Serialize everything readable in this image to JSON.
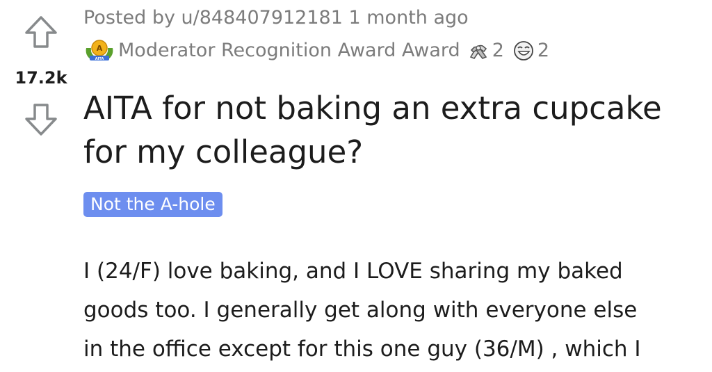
{
  "vote": {
    "score": "17.2k",
    "upvote_icon": "arrow-up-icon",
    "downvote_icon": "arrow-down-icon"
  },
  "post": {
    "posted_by_prefix": "Posted by",
    "username": "u/848407912181",
    "age": "1 month ago",
    "awards": {
      "moderator_badge_icon": "aita-moderator-badge-icon",
      "moderator_award_label": "Moderator Recognition Award Award",
      "items": [
        {
          "icon": "arm-wrestling-icon",
          "count": "2"
        },
        {
          "icon": "laughing-face-icon",
          "count": "2"
        }
      ]
    },
    "title_lines": [
      "AITA for not baking an extra cupcake",
      "for my colleague?"
    ],
    "flair": "Not the A-hole",
    "flair_color": "#6d8eef",
    "body_lines": [
      "I (24/F) love baking, and I LOVE sharing my baked",
      "goods too. I generally get along with everyone else",
      "in the office except for this one guy (36/M) , which I"
    ]
  }
}
